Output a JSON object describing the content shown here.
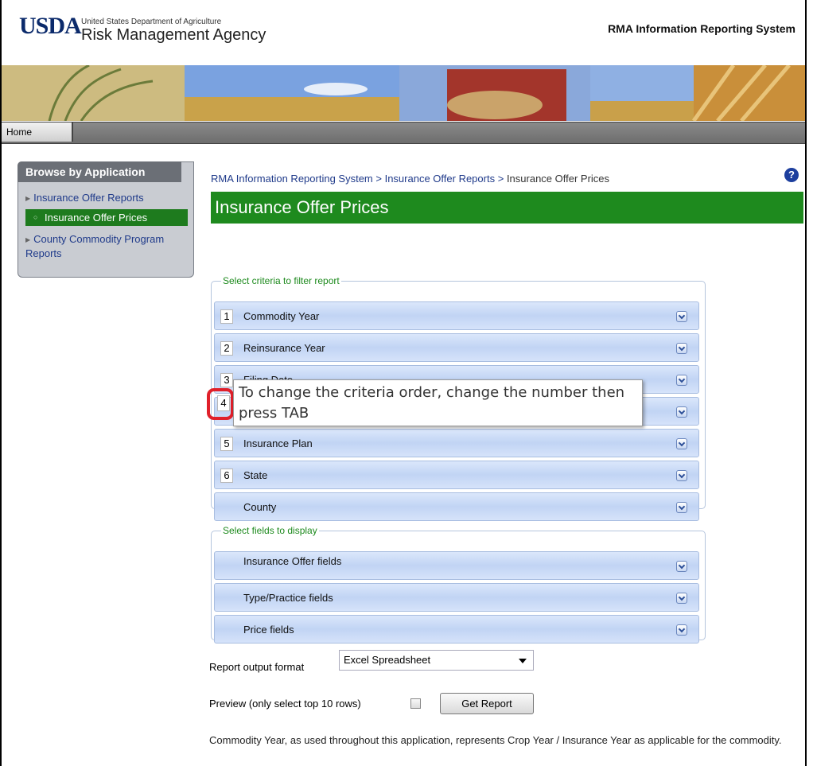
{
  "header": {
    "logo": "USDA",
    "department": "United States Department of Agriculture",
    "agency": "Risk Management Agency",
    "system_title": "RMA Information Reporting System"
  },
  "nav": {
    "home": "Home"
  },
  "sidebar": {
    "title": "Browse by Application",
    "items": [
      {
        "label": "Insurance Offer Reports"
      },
      {
        "label": "Insurance Offer Prices",
        "selected": true
      },
      {
        "label": "County Commodity Program Reports"
      }
    ]
  },
  "breadcrumb": {
    "root": "RMA Information Reporting System",
    "sep": ">",
    "section": "Insurance Offer Reports",
    "current": "Insurance Offer Prices"
  },
  "page_title": "Insurance Offer Prices",
  "help_icon": "?",
  "criteria": {
    "legend": "Select criteria to filter report",
    "rows": [
      {
        "num": "1",
        "label": "Commodity Year"
      },
      {
        "num": "2",
        "label": "Reinsurance Year"
      },
      {
        "num": "3",
        "label": "Filing Date"
      },
      {
        "num": "4",
        "label": ""
      },
      {
        "num": "5",
        "label": "Insurance Plan"
      },
      {
        "num": "6",
        "label": "State"
      },
      {
        "num": "",
        "label": "County"
      }
    ]
  },
  "tooltip": "To change the criteria order, change the number then press TAB",
  "fields": {
    "legend": "Select fields to display",
    "rows": [
      {
        "label": "Insurance Offer fields"
      },
      {
        "label": "Type/Practice fields"
      },
      {
        "label": "Price fields"
      }
    ]
  },
  "output": {
    "label": "Report output format",
    "value": "Excel Spreadsheet"
  },
  "preview": {
    "label": "Preview (only select top 10 rows)",
    "checked": false
  },
  "get_report": "Get Report",
  "note": "Commodity Year, as used throughout this application, represents Crop Year / Insurance Year as applicable for the commodity.",
  "colors": {
    "accent_green": "#1e8a1e",
    "link_blue": "#1f3a8a",
    "highlight_red": "#e0202a"
  }
}
